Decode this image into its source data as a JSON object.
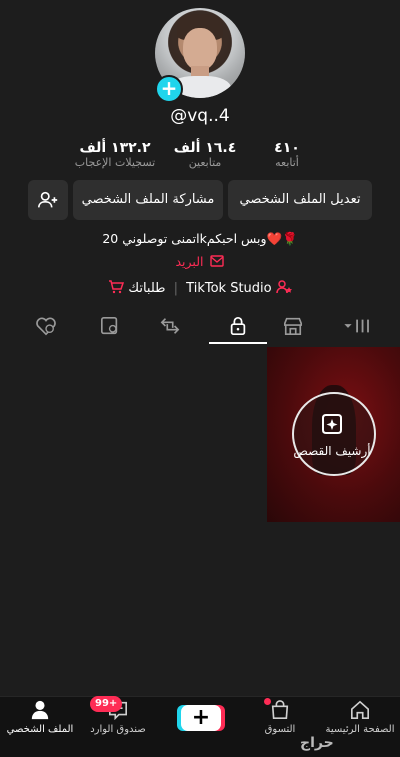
{
  "profile": {
    "username": "@vq..4",
    "stats": [
      {
        "value": "٤١٠",
        "label": "أتابعه"
      },
      {
        "value": "١٦.٤ ألف",
        "label": "متابعين"
      },
      {
        "value": "١٣٢.٢ ألف",
        "label": "تسجيلات الإعجاب"
      }
    ],
    "buttons": {
      "edit": "تعديل الملف الشخصي",
      "share": "مشاركة الملف الشخصي"
    },
    "bio": "اتمنى توصلوني 20kوبس احبكم❤️🌹",
    "email_label": "البريد",
    "links": {
      "studio": "TikTok Studio",
      "orders": "طلباتك"
    }
  },
  "tabs": [
    {
      "icon": "menu-grid-icon"
    },
    {
      "icon": "shop-icon"
    },
    {
      "icon": "lock-icon",
      "active": true
    },
    {
      "icon": "repost-icon"
    },
    {
      "icon": "tagged-icon"
    },
    {
      "icon": "liked-icon"
    }
  ],
  "content": {
    "archive_label": "أرشيف القصص"
  },
  "nav": {
    "home": "الصفحة الرئيسية",
    "shop": "التسوق",
    "create": "+",
    "inbox": "صندوق الوارد",
    "inbox_badge": "99+",
    "profile": "الملف الشخصي"
  },
  "watermark": "حراج",
  "colors": {
    "accent_red": "#fe2c55",
    "accent_cyan": "#20d5ec",
    "background": "#1d1d1d"
  }
}
